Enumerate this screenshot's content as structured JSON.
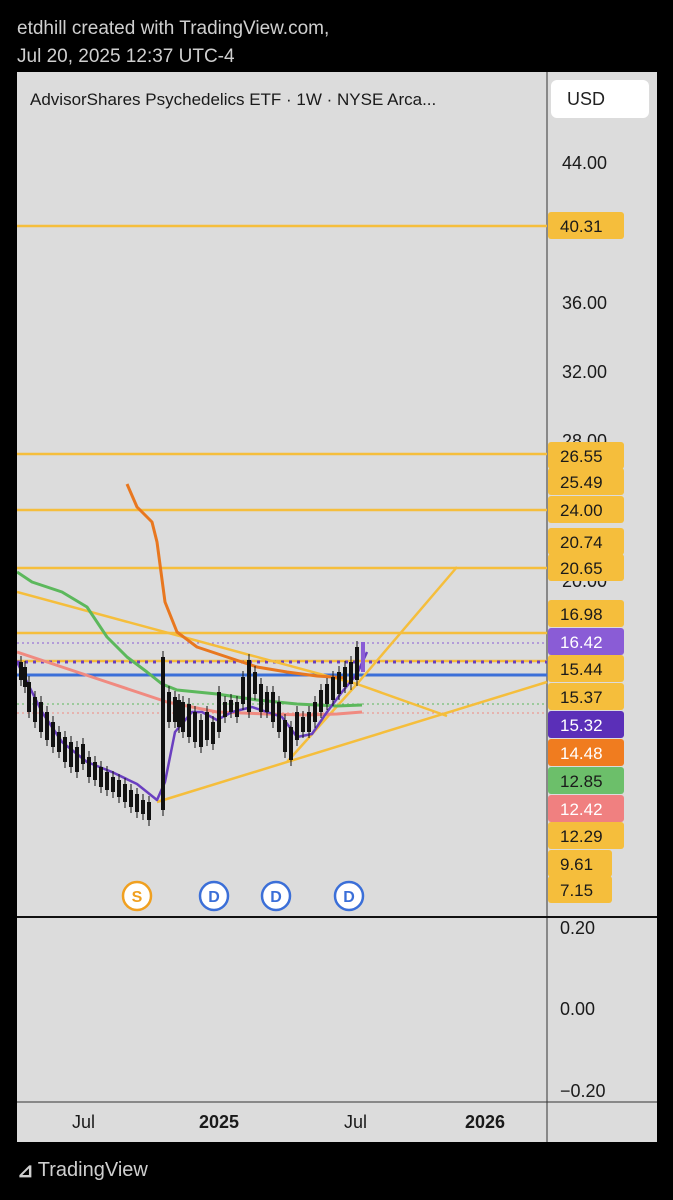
{
  "header": {
    "line1": "etdhill created with TradingView.com,",
    "line2": "Jul 20, 2025 12:37 UTC-4"
  },
  "toolbar": {
    "currency": "USD"
  },
  "footer": {
    "brand": "TradingView",
    "logo_icon": "tradingview-logo-icon"
  },
  "chart_data": {
    "type": "candlestick",
    "title": "AdvisorShares Psychedelics ETF · 1W · NYSE Arca...",
    "price_axis": {
      "ticks": [
        "44.00",
        "36.00",
        "32.00",
        "28.00",
        "20.00"
      ],
      "ylim_visible": [
        7.15,
        44.0
      ]
    },
    "indicator_axis": {
      "ticks": [
        "0.20",
        "0.00",
        "−0.20"
      ]
    },
    "time_axis": {
      "labels": [
        {
          "text": "Jul",
          "bold": false
        },
        {
          "text": "2025",
          "bold": true
        },
        {
          "text": "Jul",
          "bold": false
        },
        {
          "text": "2026",
          "bold": true
        }
      ]
    },
    "price_tags": [
      {
        "value": "40.31",
        "bg": "#f5be3c",
        "fg": "#1a1a1a"
      },
      {
        "value": "26.55",
        "bg": "#f5be3c",
        "fg": "#1a1a1a"
      },
      {
        "value": "25.49",
        "bg": "#f5be3c",
        "fg": "#1a1a1a"
      },
      {
        "value": "24.00",
        "bg": "#f5be3c",
        "fg": "#1a1a1a"
      },
      {
        "value": "20.74",
        "bg": "#f5be3c",
        "fg": "#1a1a1a"
      },
      {
        "value": "20.65",
        "bg": "#f5be3c",
        "fg": "#1a1a1a"
      },
      {
        "value": "16.98",
        "bg": "#f5be3c",
        "fg": "#1a1a1a"
      },
      {
        "value": "16.42",
        "bg": "#8a5cd6",
        "fg": "#ffffff"
      },
      {
        "value": "15.44",
        "bg": "#f5be3c",
        "fg": "#1a1a1a"
      },
      {
        "value": "15.37",
        "bg": "#f5be3c",
        "fg": "#1a1a1a"
      },
      {
        "value": "15.32",
        "bg": "#5b2fb8",
        "fg": "#ffffff"
      },
      {
        "value": "14.48",
        "bg": "#f07c1f",
        "fg": "#ffffff"
      },
      {
        "value": "12.85",
        "bg": "#6cbf6a",
        "fg": "#1a1a1a"
      },
      {
        "value": "12.42",
        "bg": "#f08080",
        "fg": "#ffffff"
      },
      {
        "value": "12.29",
        "bg": "#f5be3c",
        "fg": "#1a1a1a"
      },
      {
        "value": "9.61",
        "bg": "#f5be3c",
        "fg": "#1a1a1a"
      },
      {
        "value": "7.15",
        "bg": "#f5be3c",
        "fg": "#1a1a1a"
      }
    ],
    "horizontal_levels": [
      40.31,
      26.55,
      24.0,
      20.65,
      16.98,
      16.42,
      15.44,
      15.37
    ],
    "event_markers": [
      {
        "letter": "S",
        "color": "#f0a020"
      },
      {
        "letter": "D",
        "color": "#3b6fd8"
      },
      {
        "letter": "D",
        "color": "#3b6fd8"
      },
      {
        "letter": "D",
        "color": "#3b6fd8"
      }
    ],
    "series": [
      {
        "name": "price",
        "color": "#111111"
      },
      {
        "name": "moving-average-purple",
        "color": "#6a3fc0"
      },
      {
        "name": "moving-average-orange",
        "color": "#e8771f"
      },
      {
        "name": "moving-average-green",
        "color": "#5cb85c"
      },
      {
        "name": "moving-average-red",
        "color": "#f08a80"
      }
    ],
    "colors": {
      "level_line": "#f5be3c",
      "blue_line": "#3b6fd8",
      "purple_dotted": "#6a3fc0"
    }
  }
}
